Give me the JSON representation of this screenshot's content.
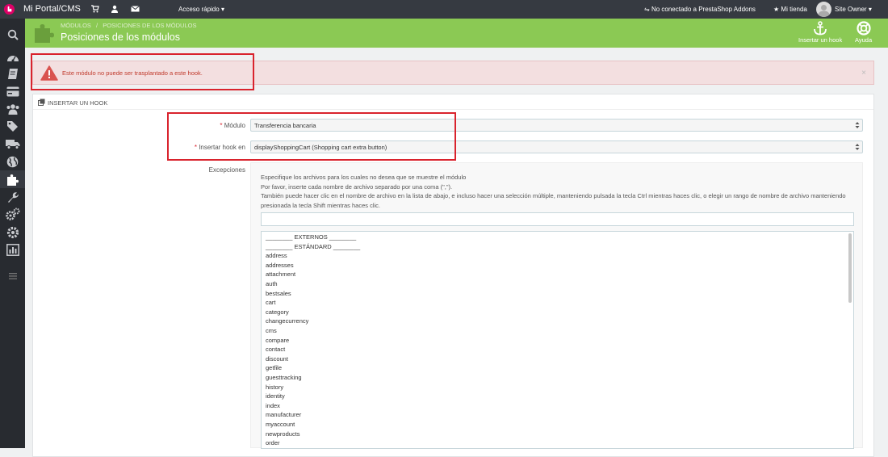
{
  "topbar": {
    "brand": "Mi Portal/CMS",
    "quick_access": "Acceso rápido",
    "addons_status": "No conectado a PrestaShop Addons",
    "shop": "Mi tienda",
    "user": "Site Owner"
  },
  "header": {
    "breadcrumb_1": "MÓDULOS",
    "breadcrumb_sep": "/",
    "breadcrumb_2": "POSICIONES DE LOS MÓDULOS",
    "title": "Posiciones de los módulos",
    "toolbar": {
      "insert_hook": "Insertar un hook",
      "help": "Ayuda"
    }
  },
  "alert": {
    "message": "Este módulo no puede ser trasplantado a este hook.",
    "close": "×"
  },
  "panel": {
    "title": "INSERTAR UN HOOK",
    "module_label": "Módulo",
    "module_value": "Transferencia bancaria",
    "hook_label": "Insertar hook en",
    "hook_value": "displayShoppingCart (Shopping cart extra button)",
    "required_mark": "*",
    "exceptions_label": "Excepciones",
    "exceptions_help": [
      "Especifique los archivos para los cuales no desea que se muestre el módulo",
      "Por favor, inserte cada nombre de archivo separado por una coma (\",\").",
      "También puede hacer clic en el nombre de archivo en la lista de abajo, e incluso hacer una selección múltiple, manteniendo pulsada la tecla Ctrl mientras haces clic, o elegir un rango de nombre de archivo manteniendo presionada la tecla Shift mientras haces clic."
    ],
    "exceptions_input": "",
    "file_list": [
      "________ EXTERNOS ________",
      "________ ESTÁNDARD ________",
      "address",
      "addresses",
      "attachment",
      "auth",
      "bestsales",
      "cart",
      "category",
      "changecurrency",
      "cms",
      "compare",
      "contact",
      "discount",
      "getfile",
      "guesttracking",
      "history",
      "identity",
      "index",
      "manufacturer",
      "myaccount",
      "newproducts",
      "order"
    ]
  },
  "colors": {
    "header_green": "#8bc954",
    "topbar": "#363a41",
    "sidebar": "#282b30",
    "alert_bg": "#f3dfe0",
    "alert_text": "#c0392b",
    "highlight_red": "#d9232d"
  },
  "sidebar_icons": [
    "search-icon",
    "dashboard-icon",
    "catalog-icon",
    "orders-icon",
    "customers-icon",
    "price-rules-icon",
    "shipping-icon",
    "localization-icon",
    "modules-icon",
    "preferences-icon",
    "advanced-params-icon",
    "administration-icon",
    "stats-icon",
    "menu-toggle-icon"
  ]
}
